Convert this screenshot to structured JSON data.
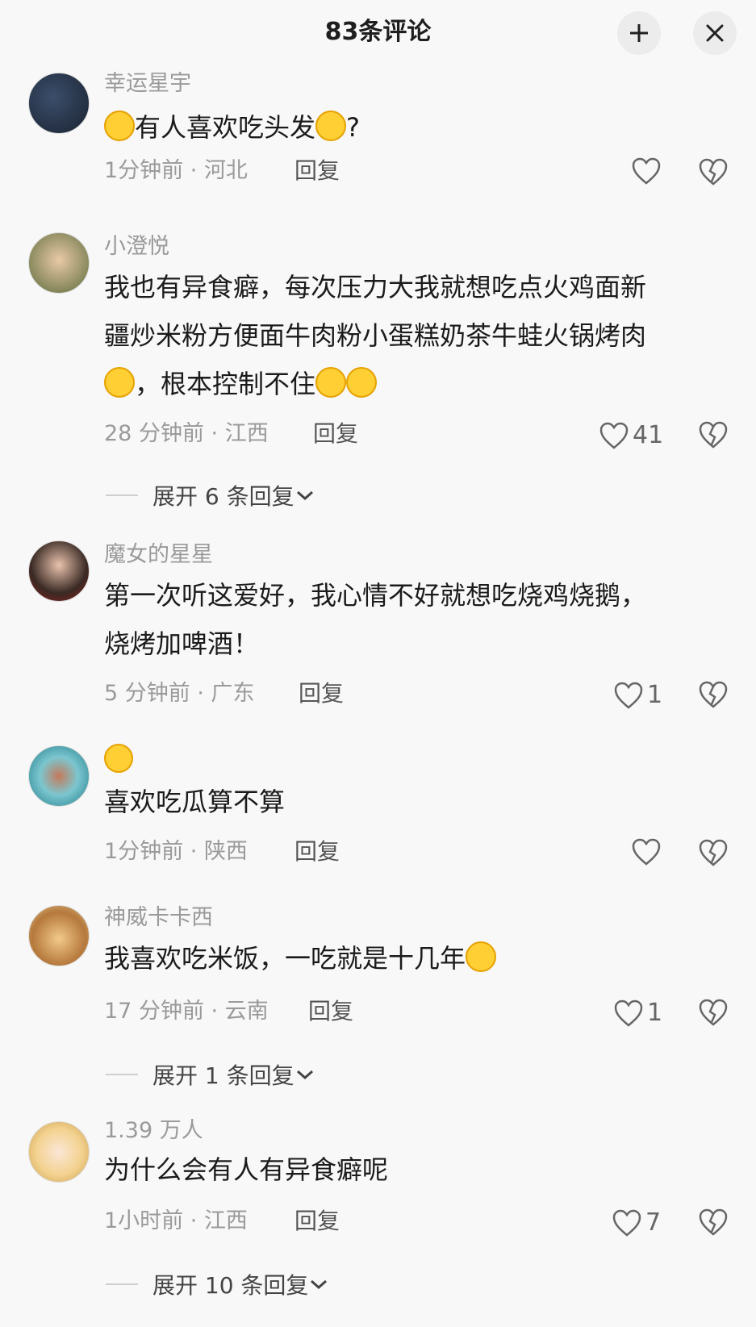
{
  "header": {
    "title": "83条评论"
  },
  "comments": [
    {
      "username": "幸运星宇",
      "text_before": "",
      "text_mid": "有人喜欢吃头发",
      "text_after": "?",
      "time": "1分钟前",
      "location": "河北",
      "reply_label": "回复",
      "likes": ""
    },
    {
      "username": "小澄悦",
      "line1": "我也有异食癖，每次压力大我就想吃点火鸡面新",
      "line2": "疆炒米粉方便面牛肉粉小蛋糕奶茶牛蛙火锅烤肉",
      "line3": "，根本控制不住",
      "time": "28 分钟前",
      "location": "江西",
      "reply_label": "回复",
      "likes": "41",
      "expand": "展开 6 条回复"
    },
    {
      "username": "魔女的星星",
      "line1": "第一次听这爱好，我心情不好就想吃烧鸡烧鹅，",
      "line2": "烧烤加啤酒！",
      "time": "5 分钟前",
      "location": "广东",
      "reply_label": "回复",
      "likes": "1"
    },
    {
      "username": "",
      "line1": "喜欢吃瓜算不算",
      "time": "1分钟前",
      "location": "陕西",
      "reply_label": "回复",
      "likes": ""
    },
    {
      "username": "神威卡卡西",
      "line1": "我喜欢吃米饭，一吃就是十几年",
      "time": "17 分钟前",
      "location": "云南",
      "reply_label": "回复",
      "likes": "1",
      "expand": "展开 1 条回复"
    },
    {
      "username": "1.39 万人",
      "line1": "为什么会有人有异食癖呢",
      "time": "1小时前",
      "location": "江西",
      "reply_label": "回复",
      "likes": "7",
      "expand": "展开 10 条回复"
    }
  ],
  "icons": {
    "like": "heart-outline-icon",
    "dislike": "broken-heart-icon",
    "expand": "plus-icon",
    "close": "close-icon"
  },
  "colors": {
    "background": "#f8f8f8",
    "meta": "#9a9a9a",
    "emoji": "#ffcf33"
  }
}
